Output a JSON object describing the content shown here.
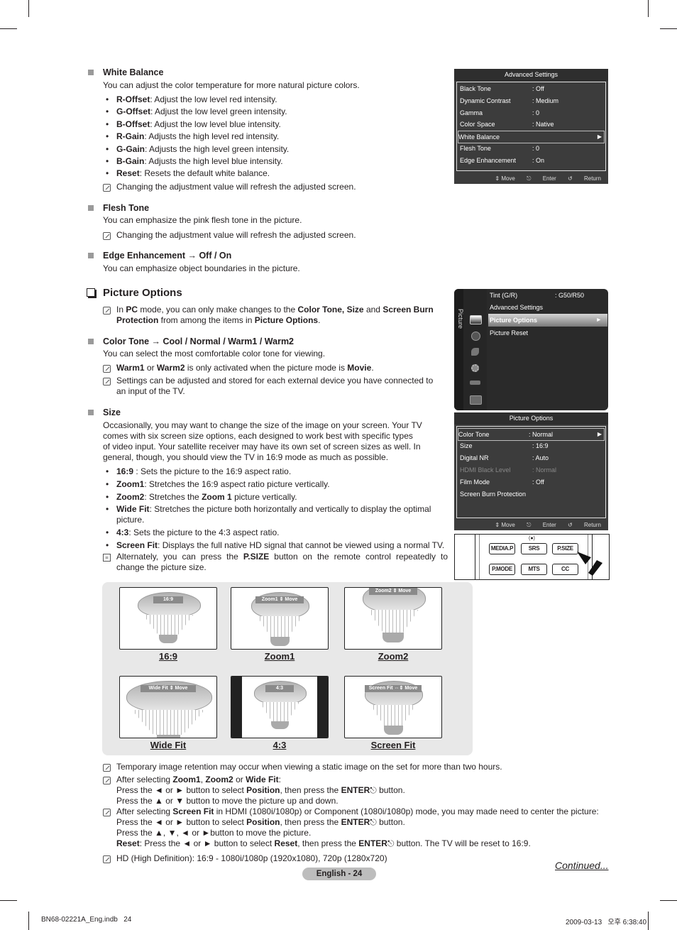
{
  "white_balance": {
    "heading": "White Balance",
    "intro": "You can adjust the color temperature for more natural picture colors.",
    "items": [
      {
        "term": "R-Offset",
        "desc": ": Adjust the low level red intensity."
      },
      {
        "term": "G-Offset",
        "desc": ": Adjust the low level green intensity."
      },
      {
        "term": "B-Offset",
        "desc": ": Adjust the low level blue intensity."
      },
      {
        "term": "R-Gain",
        "desc": ": Adjusts the high level red intensity."
      },
      {
        "term": "G-Gain",
        "desc": ": Adjusts the high level green intensity."
      },
      {
        "term": "B-Gain",
        "desc": ": Adjusts the high level blue intensity."
      },
      {
        "term": "Reset",
        "desc": ": Resets the default white balance."
      }
    ],
    "note": "Changing the adjustment value will refresh the adjusted screen."
  },
  "flesh_tone": {
    "heading": "Flesh Tone",
    "intro": "You can emphasize the pink flesh tone in the picture.",
    "note": "Changing the adjustment value will refresh the adjusted screen."
  },
  "edge_enhancement": {
    "heading": "Edge Enhancement → Off / On",
    "intro": "You can emphasize object boundaries in the picture."
  },
  "picture_options": {
    "heading": "Picture Options",
    "note_parts": [
      "In ",
      "PC",
      " mode, you can only make changes to the ",
      "Color Tone, Size",
      " and ",
      "Screen Burn",
      "Protection",
      " from among the items in ",
      "Picture Options",
      "."
    ]
  },
  "color_tone": {
    "heading": "Color Tone → Cool / Normal / Warm1 / Warm2",
    "intro": "You can select the most comfortable color tone for viewing.",
    "note1_parts": [
      "Warm1",
      " or ",
      "Warm2",
      " is only activated when the picture mode is ",
      "Movie",
      "."
    ],
    "note2_line1": "Settings can be adjusted and stored for each external device you have connected to",
    "note2_line2": "an input of the TV."
  },
  "size": {
    "heading": "Size",
    "intro_lines": [
      "Occasionally, you may want to change the size of the image on your screen. Your TV",
      "comes with six screen size options, each designed to work best with specific types",
      "of video input. Your satellite receiver may have its own set of screen sizes as well. In",
      "general, though, you should view the TV in 16:9 mode as much as possible."
    ],
    "items": [
      {
        "term": "16:9",
        "desc": " : Sets the picture to the 16:9 aspect ratio."
      },
      {
        "term": "Zoom1",
        "desc": ": Stretches the 16:9 aspect ratio picture vertically."
      },
      {
        "term": "Zoom2",
        "desc": ":  Stretches the ",
        "term2": "Zoom 1",
        "desc2": " picture vertically."
      },
      {
        "term": "Wide Fit",
        "desc": ": Stretches the picture both horizontally and vertically to display the optimal",
        "desc_cont": "picture."
      },
      {
        "term": "4:3",
        "desc": ": Sets the picture to the 4:3 aspect ratio."
      },
      {
        "term": "Screen Fit",
        "desc": ": Displays the full native HD signal that cannot be viewed using a normal TV."
      }
    ],
    "memo_parts": [
      "Alternately, you can press the ",
      "P.SIZE",
      " button on the remote control repeatedly to"
    ],
    "memo_cont": "change the picture size."
  },
  "gallery": [
    {
      "caption": "16:9",
      "tag": "16:9"
    },
    {
      "caption": "Zoom1",
      "tag": "Zoom1 ⇕ Move"
    },
    {
      "caption": "Zoom2",
      "tag": "Zoom2 ⇕ Move"
    },
    {
      "caption": "Wide Fit",
      "tag": "Wide Fit ⇕ Move"
    },
    {
      "caption": "4:3",
      "tag": "4:3"
    },
    {
      "caption": "Screen Fit",
      "tag": "Screen Fit ⇔⇕ Move"
    }
  ],
  "bottom_notes": {
    "n1": "Temporary image retention may occur when viewing a static image on the set for more than two hours.",
    "n2_parts": [
      "After selecting ",
      "Zoom1",
      ", ",
      "Zoom2",
      " or ",
      "Wide Fit",
      ":"
    ],
    "n2_l2_parts": [
      "Press the ◄ or ► button to select ",
      "Position",
      ", then press the ",
      "ENTER",
      " button."
    ],
    "n2_l3": "Press the ▲ or ▼ button to move the picture up and down.",
    "n3_parts": [
      "After selecting ",
      "Screen Fit",
      " in HDMI (1080i/1080p) or Component (1080i/1080p) mode, you may made need to center the picture:"
    ],
    "n3_l2_parts": [
      "Press the ◄ or ► button to select ",
      "Position",
      ", then press the ",
      "ENTER",
      " button."
    ],
    "n3_l3": "Press the ▲, ▼, ◄ or ►button to move the picture.",
    "n3_l4_parts": [
      "Reset",
      ": Press the ◄ or ► button to select ",
      "Reset",
      ", then press the ",
      "ENTER",
      " button. The TV will be reset to 16:9."
    ],
    "n4": "HD (High Definition): 16:9 - 1080i/1080p (1920x1080), 720p (1280x720)"
  },
  "continued": "Continued...",
  "page_label": "English - 24",
  "footer": {
    "left": "BN68-02221A_Eng.indb   24",
    "right": "2009-03-13   오후 6:38:40"
  },
  "osd_advanced": {
    "title": "Advanced Settings",
    "rows": [
      {
        "label": "Black Tone",
        "value": ": Off"
      },
      {
        "label": "Dynamic Contrast",
        "value": ": Medium"
      },
      {
        "label": "Gamma",
        "value": ": 0"
      },
      {
        "label": "Color Space",
        "value": ": Native"
      },
      {
        "label": "White Balance",
        "value": "",
        "selected": true
      },
      {
        "label": "Flesh Tone",
        "value": ": 0"
      },
      {
        "label": "Edge Enhancement",
        "value": ": On"
      }
    ],
    "footer": {
      "move": "⇕ Move",
      "enter": "Enter",
      "return": "Return"
    }
  },
  "osd_picture_menu": {
    "side_label": "Picture",
    "rows": [
      {
        "label": "Tint (G/R)",
        "value": ": G50/R50"
      },
      {
        "label": "Advanced Settings",
        "value": ""
      },
      {
        "label": "Picture Options",
        "value": "",
        "selected": true
      },
      {
        "label": "Picture Reset",
        "value": ""
      }
    ]
  },
  "osd_picture_options": {
    "title": "Picture Options",
    "rows": [
      {
        "label": "Color Tone",
        "value": ": Normal",
        "selected": true
      },
      {
        "label": "Size",
        "value": ": 16:9"
      },
      {
        "label": "Digital NR",
        "value": ": Auto"
      },
      {
        "label": "HDMI Black Level",
        "value": ": Normal",
        "disabled": true
      },
      {
        "label": "Film Mode",
        "value": ": Off"
      },
      {
        "label": "Screen Burn Protection",
        "value": ""
      }
    ],
    "footer": {
      "move": "⇕ Move",
      "enter": "Enter",
      "return": "Return"
    }
  },
  "remote": {
    "srs_mark": "(●)",
    "buttons": [
      "MEDIA.P",
      "SRS",
      "P.SIZE",
      "P.MODE",
      "MTS",
      "CC"
    ]
  }
}
